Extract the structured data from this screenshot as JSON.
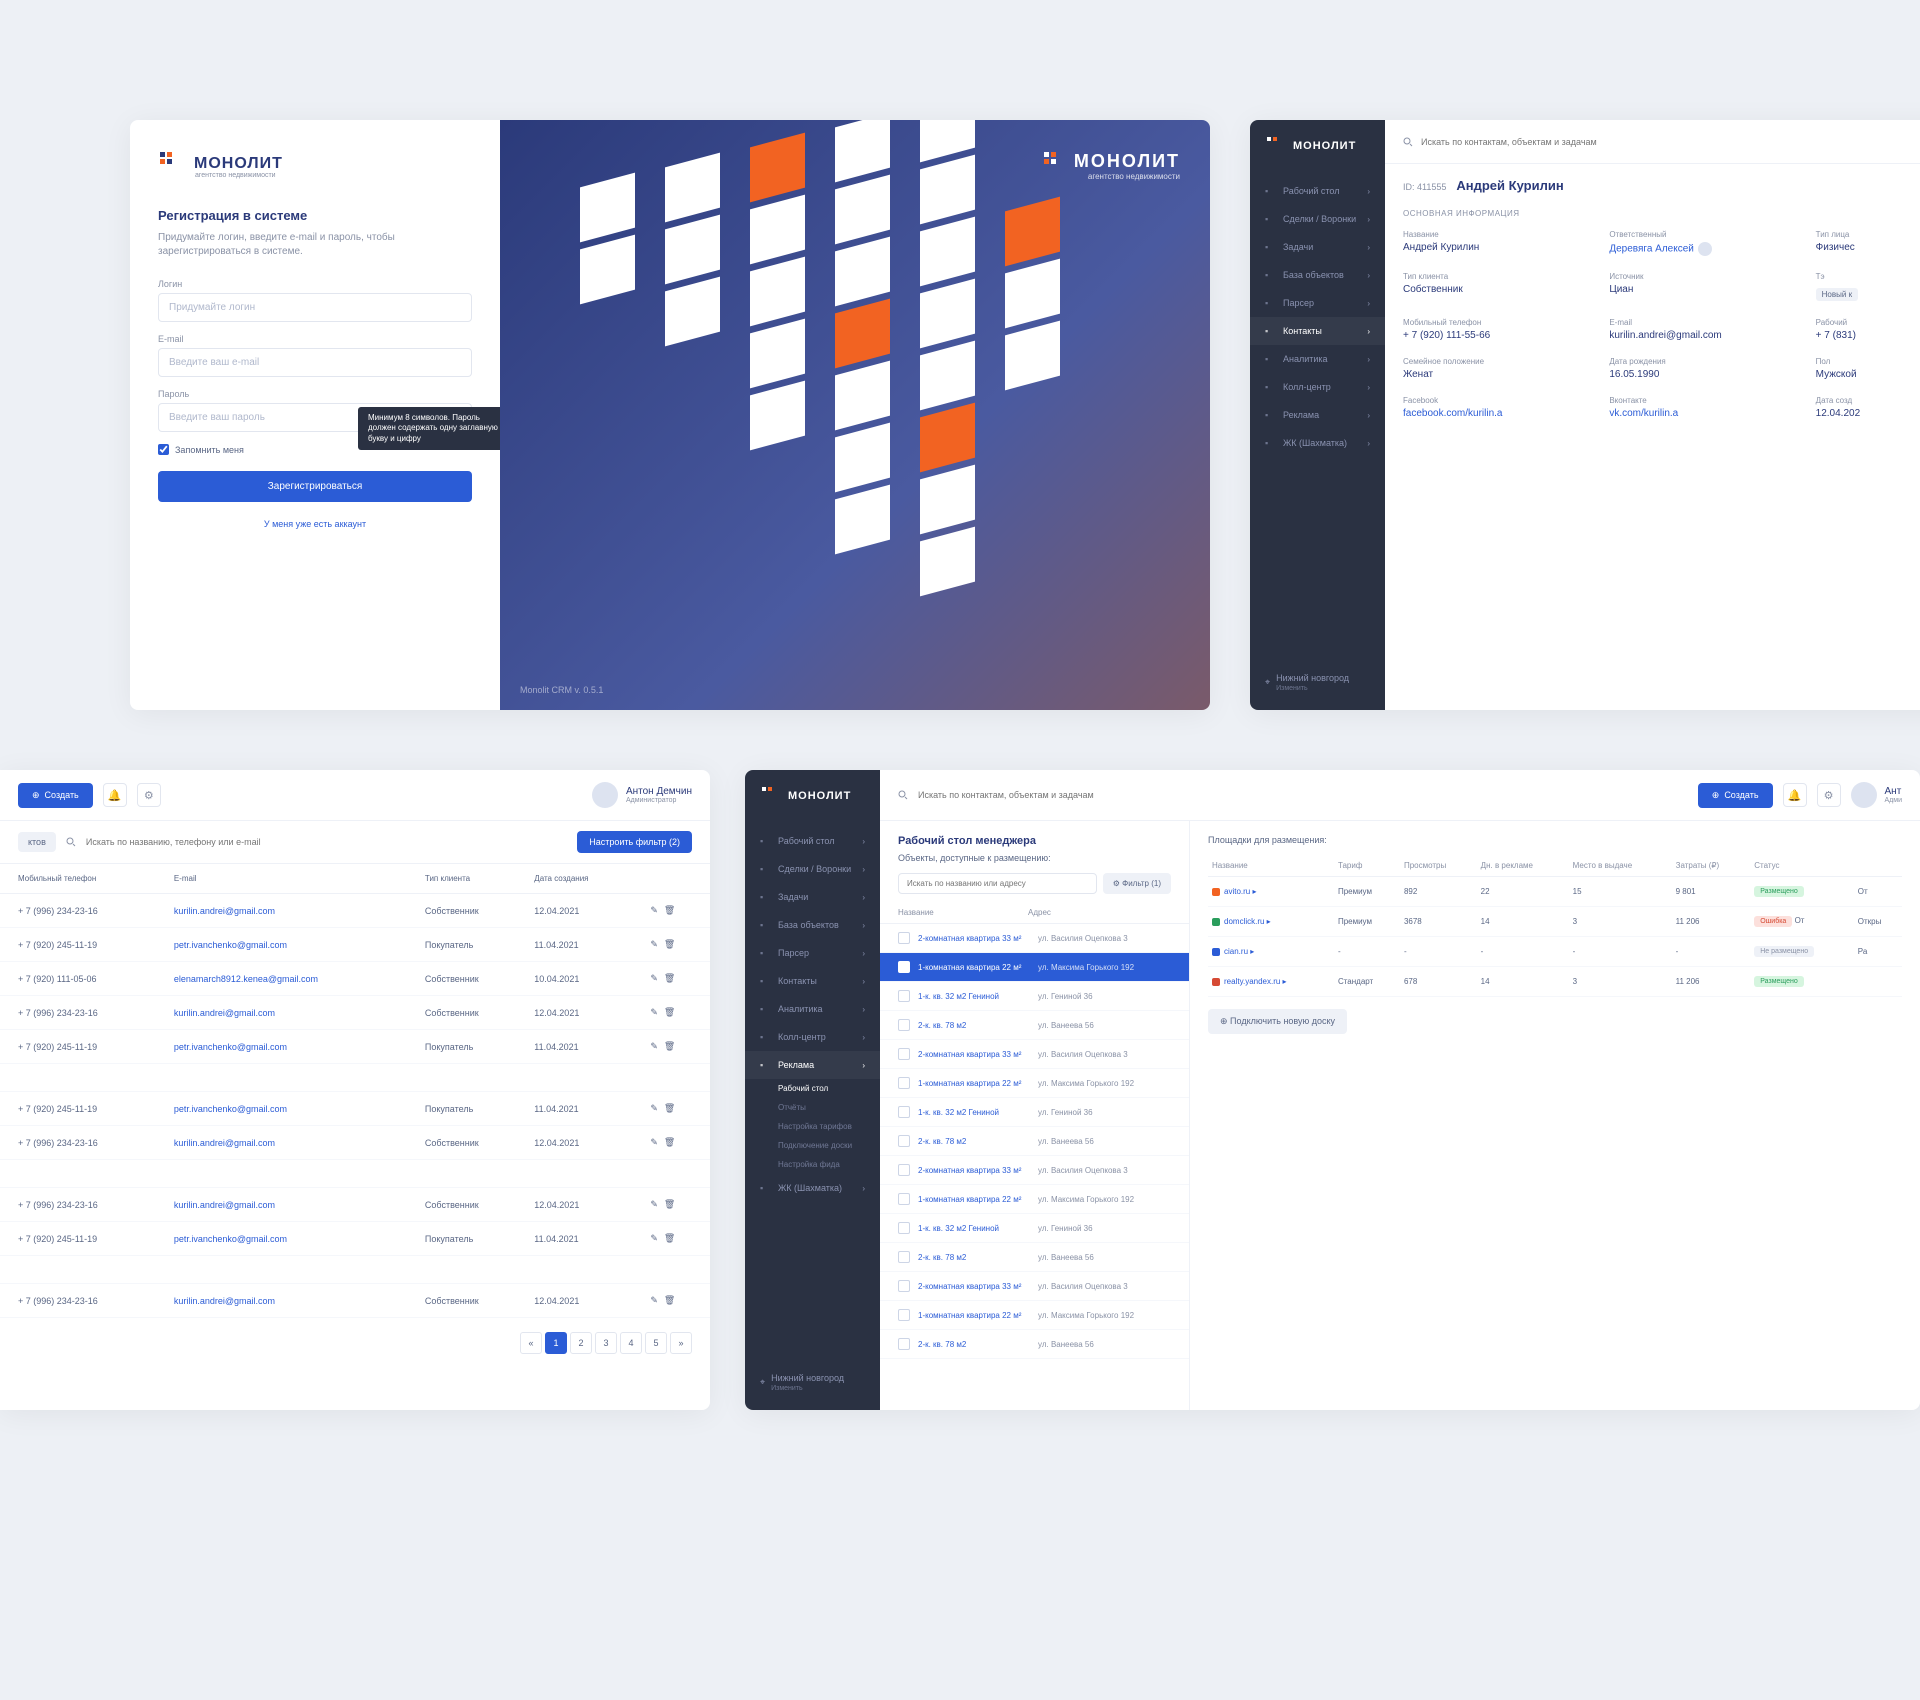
{
  "brand": {
    "name": "МОНОЛИТ",
    "sub": "агентство недвижимости",
    "version": "Monolit CRM v. 0.5.1"
  },
  "login": {
    "title": "Регистрация в системе",
    "hint": "Придумайте логин, введите e-mail и пароль, чтобы зарегистрироваться в системе.",
    "fields": {
      "login": "Логин",
      "login_ph": "Придумайте логин",
      "email": "E-mail",
      "email_ph": "Введите ваш e-mail",
      "password": "Пароль",
      "password_ph": "Введите ваш пароль"
    },
    "tooltip": "Минимум 8 символов. Пароль должен содержать одну заглавную букву и цифру",
    "remember": "Запомнить меня",
    "submit": "Зарегистрироваться",
    "have_account": "У меня уже есть аккаунт"
  },
  "menu": {
    "items": [
      "Рабочий стол",
      "Сделки / Воронки",
      "Задачи",
      "База объектов",
      "Парсер",
      "Контакты",
      "Аналитика",
      "Колл-центр",
      "Реклама",
      "ЖК (Шахматка)"
    ],
    "active": 5,
    "ads_sub": [
      "Рабочий стол",
      "Отчёты",
      "Настройка тарифов",
      "Подключение доски",
      "Настройка фида"
    ],
    "city": "Нижний новгород",
    "city_action": "Изменить"
  },
  "topbar": {
    "search_ph": "Искать по контактам, объектам и задачам",
    "create": "Создать",
    "user": "Антон Демчин",
    "role": "Администратор"
  },
  "contact": {
    "id_label": "ID: 411555",
    "name": "Андрей Курилин",
    "section": "ОСНОВНАЯ ИНФОРМАЦИЯ",
    "fields": [
      {
        "l": "Название",
        "v": "Андрей Курилин"
      },
      {
        "l": "Ответственный",
        "v": "Деревяга Алексей",
        "link": true,
        "avatar": true
      },
      {
        "l": "Тип лица",
        "v": "Физичес"
      },
      {
        "l": "Тип клиента",
        "v": "Собственник"
      },
      {
        "l": "Источник",
        "v": "Циан"
      },
      {
        "l": "Тэ",
        "v": "",
        "badge": "Новый к"
      },
      {
        "l": "Мобильный телефон",
        "v": "+ 7 (920) 111-55-66"
      },
      {
        "l": "E-mail",
        "v": "kurilin.andrei@gmail.com"
      },
      {
        "l": "Рабочий",
        "v": "+ 7 (831)"
      },
      {
        "l": "Семейное положение",
        "v": "Женат"
      },
      {
        "l": "Дата рождения",
        "v": "16.05.1990"
      },
      {
        "l": "Пол",
        "v": "Мужской"
      },
      {
        "l": "Facebook",
        "v": "facebook.com/kurilin.a",
        "link": true
      },
      {
        "l": "Вконтакте",
        "v": "vk.com/kurilin.a",
        "link": true
      },
      {
        "l": "Дата созд",
        "v": "12.04.202"
      }
    ]
  },
  "table": {
    "tab": "ктов",
    "search_ph": "Искать по названию, телефону или e-mail",
    "filter_btn": "Настроить фильтр (2)",
    "columns": [
      "Мобильный телефон",
      "E-mail",
      "Тип клиента",
      "Дата создания"
    ],
    "rows": [
      {
        "phone": "+ 7 (996) 234-23-16",
        "email": "kurilin.andrei@gmail.com",
        "type": "Собственник",
        "date": "12.04.2021"
      },
      {
        "phone": "+ 7 (920) 245-11-19",
        "email": "petr.ivanchenko@gmail.com",
        "type": "Покупатель",
        "date": "11.04.2021"
      },
      {
        "phone": "+ 7 (920) 111-05-06",
        "email": "elenamarch8912.kenea@gmail.com",
        "type": "Собственник",
        "date": "10.04.2021"
      },
      {
        "phone": "+ 7 (996) 234-23-16",
        "email": "kurilin.andrei@gmail.com",
        "type": "Собственник",
        "date": "12.04.2021"
      },
      {
        "phone": "+ 7 (920) 245-11-19",
        "email": "petr.ivanchenko@gmail.com",
        "type": "Покупатель",
        "date": "11.04.2021"
      },
      {
        "phone": "",
        "email": "",
        "type": "",
        "date": "",
        "spacer": true
      },
      {
        "phone": "+ 7 (920) 245-11-19",
        "email": "petr.ivanchenko@gmail.com",
        "type": "Покупатель",
        "date": "11.04.2021"
      },
      {
        "phone": "+ 7 (996) 234-23-16",
        "email": "kurilin.andrei@gmail.com",
        "type": "Собственник",
        "date": "12.04.2021"
      },
      {
        "phone": "",
        "email": "",
        "type": "",
        "date": "",
        "spacer": true
      },
      {
        "phone": "+ 7 (996) 234-23-16",
        "email": "kurilin.andrei@gmail.com",
        "type": "Собственник",
        "date": "12.04.2021"
      },
      {
        "phone": "+ 7 (920) 245-11-19",
        "email": "petr.ivanchenko@gmail.com",
        "type": "Покупатель",
        "date": "11.04.2021"
      },
      {
        "phone": "",
        "email": "",
        "type": "",
        "date": "",
        "spacer": true
      },
      {
        "phone": "+ 7 (996) 234-23-16",
        "email": "kurilin.andrei@gmail.com",
        "type": "Собственник",
        "date": "12.04.2021"
      }
    ],
    "pages": [
      "«",
      "1",
      "2",
      "3",
      "4",
      "5",
      "»"
    ],
    "active_page": 1
  },
  "dash": {
    "title": "Рабочий стол менеджера",
    "obj_title": "Объекты, доступные к размещению:",
    "obj_search_ph": "Искать по названию или адресу",
    "obj_filter": "Фильтр (1)",
    "obj_cols": [
      "Название",
      "Адрес"
    ],
    "objects": [
      {
        "n": "2-комнатная квартира 33 м²",
        "a": "ул. Василия Оцепкова 3"
      },
      {
        "n": "1-комнатная квартира 22 м²",
        "a": "ул. Максима Горького 192",
        "sel": true
      },
      {
        "n": "1-к. кв. 32 м2 Гениной",
        "a": "ул. Гениной 36"
      },
      {
        "n": "2-к. кв. 78 м2",
        "a": "ул. Ванеева 56"
      },
      {
        "n": "2-комнатная квартира 33 м²",
        "a": "ул. Василия Оцепкова 3"
      },
      {
        "n": "1-комнатная квартира 22 м²",
        "a": "ул. Максима Горького 192"
      },
      {
        "n": "1-к. кв. 32 м2 Гениной",
        "a": "ул. Гениной 36"
      },
      {
        "n": "2-к. кв. 78 м2",
        "a": "ул. Ванеева 56"
      },
      {
        "n": "2-комнатная квартира 33 м²",
        "a": "ул. Василия Оцепкова 3"
      },
      {
        "n": "1-комнатная квартира 22 м²",
        "a": "ул. Максима Горького 192"
      },
      {
        "n": "1-к. кв. 32 м2 Гениной",
        "a": "ул. Гениной 36"
      },
      {
        "n": "2-к. кв. 78 м2",
        "a": "ул. Ванеева 56"
      },
      {
        "n": "2-комнатная квартира 33 м²",
        "a": "ул. Василия Оцепкова 3"
      },
      {
        "n": "1-комнатная квартира 22 м²",
        "a": "ул. Максима Горького 192"
      },
      {
        "n": "2-к. кв. 78 м2",
        "a": "ул. Ванеева 56"
      }
    ],
    "plat_title": "Площадки для размещения:",
    "plat_cols": [
      "Название",
      "Тариф",
      "Просмотры",
      "Дн. в рекламе",
      "Место в выдаче",
      "Затраты (₽)",
      "Статус",
      ""
    ],
    "platforms": [
      {
        "site": "avito.ru",
        "c": "#f26322",
        "tariff": "Премиум",
        "views": "892",
        "days": "22",
        "rank": "15",
        "cost": "9 801",
        "status": "Размещено",
        "pill": "green",
        "extra": "От"
      },
      {
        "site": "domclick.ru",
        "c": "#2a9d5c",
        "tariff": "Премиум",
        "views": "3678",
        "days": "14",
        "rank": "3",
        "cost": "11 206",
        "status": "Ошибка",
        "pill": "red",
        "extra": "Откры",
        "extra2": "От"
      },
      {
        "site": "cian.ru",
        "c": "#2b5cd6",
        "tariff": "-",
        "views": "-",
        "days": "-",
        "rank": "-",
        "cost": "-",
        "status": "Не размещено",
        "pill": "gray",
        "extra": "Ра"
      },
      {
        "site": "realty.yandex.ru",
        "c": "#d64a34",
        "tariff": "Стандарт",
        "views": "678",
        "days": "14",
        "rank": "3",
        "cost": "11 206",
        "status": "Размещено",
        "pill": "green",
        "extra": ""
      }
    ],
    "connect": "Подключить новую доску"
  }
}
